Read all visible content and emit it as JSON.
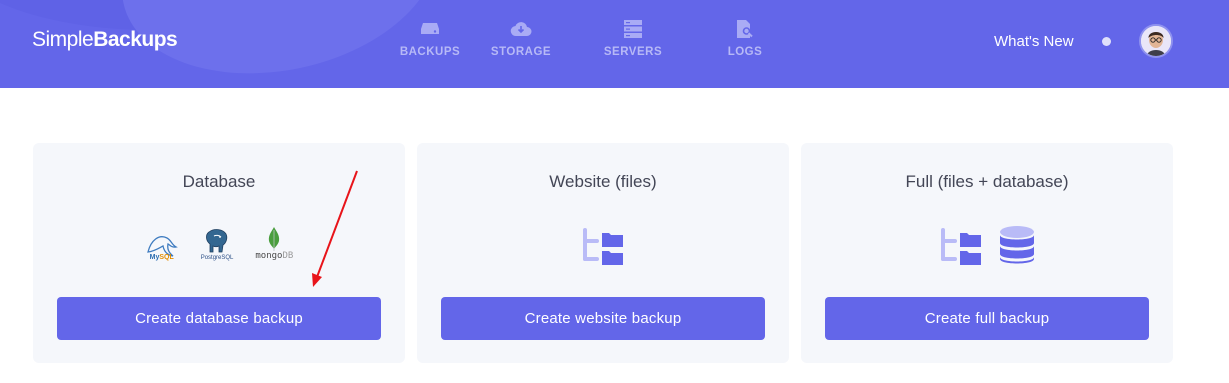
{
  "app": {
    "logo_regular": "Simple",
    "logo_bold": "Backups"
  },
  "nav": [
    {
      "label": "BACKUPS",
      "icon": "server-drive-icon"
    },
    {
      "label": "STORAGE",
      "icon": "cloud-download-icon"
    },
    {
      "label": "SERVERS",
      "icon": "server-stack-icon"
    },
    {
      "label": "LOGS",
      "icon": "file-search-icon"
    }
  ],
  "header": {
    "whats_new": "What's New"
  },
  "cards": [
    {
      "title": "Database",
      "button": "Create database backup",
      "logos": {
        "mysql_a": "My",
        "mysql_b": "SQL",
        "postgres": "PostgreSQL",
        "mongo_a": "mongo",
        "mongo_b": "DB"
      }
    },
    {
      "title": "Website (files)",
      "button": "Create website backup"
    },
    {
      "title": "Full (files + database)",
      "button": "Create full backup"
    }
  ],
  "colors": {
    "accent": "#6366e9",
    "card_bg": "#f5f7fb",
    "icon_light": "#b9bbf7",
    "annotation_arrow": "#e8141a"
  }
}
